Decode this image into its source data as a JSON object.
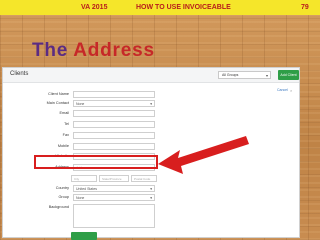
{
  "banner": {
    "course": "VA 2015",
    "topic": "HOW TO USE INVOICEABLE",
    "page": "79"
  },
  "slide_title": {
    "word1": "The",
    "word2": "Address"
  },
  "panel": {
    "title": "Clients",
    "group_select": "All Groups",
    "add_client": "Add Client",
    "cancel": "Cancel",
    "form": {
      "client_name": {
        "label": "Client Name",
        "value": ""
      },
      "main_contact": {
        "label": "Main Contact",
        "value": "None"
      },
      "email": {
        "label": "Email",
        "value": ""
      },
      "tel": {
        "label": "Tel",
        "value": ""
      },
      "fax": {
        "label": "Fax",
        "value": ""
      },
      "mobile": {
        "label": "Mobile",
        "value": ""
      },
      "website": {
        "label": "Website",
        "value": ""
      },
      "address": {
        "label": "Address",
        "placeholder": "Address"
      },
      "city": {
        "placeholder": "City"
      },
      "state": {
        "placeholder": "State/Province"
      },
      "postal": {
        "placeholder": "Postal Code"
      },
      "country": {
        "label": "Country",
        "value": "United States"
      },
      "group": {
        "label": "Group",
        "value": "None"
      },
      "background": {
        "label": "Background",
        "value": ""
      }
    }
  },
  "colors": {
    "banner_bg": "#f5e62a",
    "title_purple": "#5b2c83",
    "title_red": "#c62828",
    "highlight_red": "#d81e1e",
    "button_green": "#2e9e47"
  }
}
